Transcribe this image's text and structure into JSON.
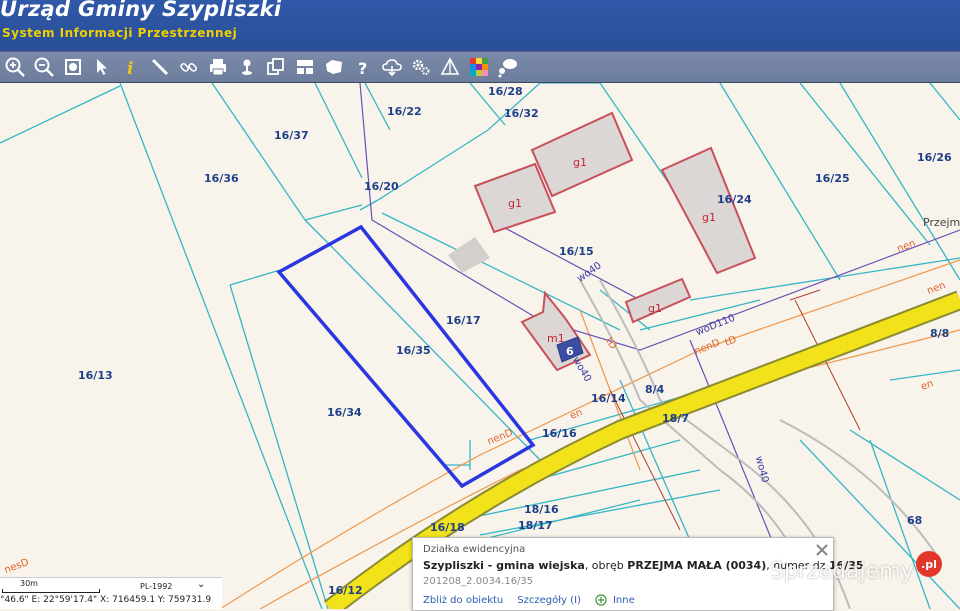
{
  "header": {
    "title": "Urząd Gminy Szypliszki",
    "subtitle": "System Informacji Przestrzennej"
  },
  "toolbar": {
    "tools": [
      "zoom-in-icon",
      "zoom-out-icon",
      "zoom-extent-icon",
      "select-arrow-icon",
      "info-icon",
      "measure-icon",
      "link-icon",
      "print-icon",
      "pin-icon",
      "copy-icon",
      "layout-icon",
      "map-shape-icon",
      "help-icon",
      "cloud-download-icon",
      "settings-icon",
      "triangle-icon",
      "color-palette-icon",
      "chat-icon"
    ]
  },
  "map": {
    "parcels": [
      "16/28",
      "16/22",
      "16/32",
      "16/37",
      "16/36",
      "16/20",
      "16/26",
      "16/25",
      "16/24",
      "16/15",
      "16/17",
      "16/35",
      "16/13",
      "16/34",
      "16/14",
      "8/4",
      "18/7",
      "8/8",
      "16/16",
      "18/16",
      "18/17",
      "16/18",
      "16/12",
      "68"
    ],
    "buildings": [
      "g1",
      "g1",
      "g1",
      "g1",
      "m1",
      "6"
    ],
    "utility_labels": [
      "nen",
      "nen",
      "nenD",
      "nenD",
      "en",
      "en",
      "nesD",
      "tD",
      "tD"
    ],
    "road_labels": [
      "woD110",
      "wo40",
      "wo40",
      "wo40"
    ],
    "place_label": "Przejm"
  },
  "scale": {
    "distance": "30m",
    "crs": "PL-1992"
  },
  "coords": {
    "text": "°46.6\" E: 22°59'17.4\"  X: 716459.1  Y: 759731.9"
  },
  "popup": {
    "title": "Działka ewidencyjna",
    "bold1": "Szypliszki - gmina wiejska",
    "text1": ", obręb ",
    "bold2": "PRZEJMA MAŁA (0034)",
    "text2": ", numer dz ",
    "bold3": "16/35",
    "id": "201208_2.0034.16/35",
    "link_zoom": "Zbliż do obiektu",
    "link_details": "Szczegóły (I)",
    "link_more": "Inne"
  },
  "watermark": {
    "text": "Sprzedajemy",
    "badge": ".pl"
  },
  "colors": {
    "header_bg": "#2f58a8",
    "subtitle": "#f0d000",
    "parcel_line": "#35b6c6",
    "selected_parcel": "#2a36e0",
    "road_yellow": "#f2e21a",
    "building_fill": "#dcd6d4",
    "building_stroke": "#c8505a"
  }
}
